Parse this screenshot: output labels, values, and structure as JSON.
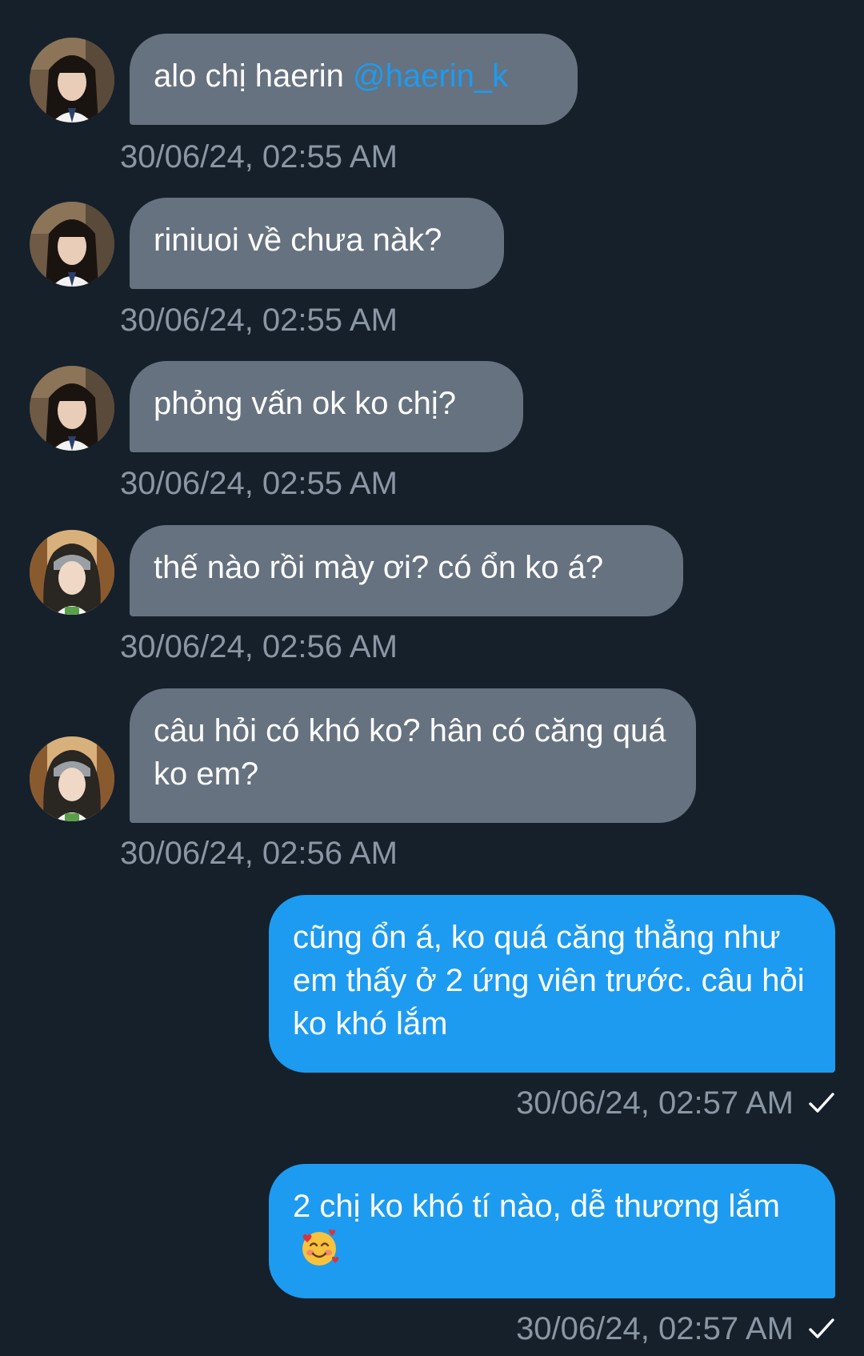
{
  "messages": [
    {
      "id": 1,
      "direction": "in",
      "avatar": "avatar-haerin-icon",
      "text": "alo chị haerin ",
      "mention": "@haerin_k",
      "timestamp": "30/06/24, 02:55 AM"
    },
    {
      "id": 2,
      "direction": "in",
      "avatar": "avatar-haerin-icon",
      "text": "riniuoi về chưa nàk?",
      "timestamp": "30/06/24, 02:55 AM"
    },
    {
      "id": 3,
      "direction": "in",
      "avatar": "avatar-haerin-icon",
      "text": "phỏng vấn ok ko chị?",
      "timestamp": "30/06/24, 02:55 AM"
    },
    {
      "id": 4,
      "direction": "in",
      "avatar": "avatar-second-user-icon",
      "text": "thế nào rồi mày ơi? có ổn ko á?",
      "timestamp": "30/06/24, 02:56 AM"
    },
    {
      "id": 5,
      "direction": "in",
      "avatar": "avatar-second-user-icon",
      "text": "câu hỏi có khó ko? hân có căng quá ko em?",
      "timestamp": "30/06/24, 02:56 AM"
    },
    {
      "id": 6,
      "direction": "out",
      "text": "cũng ổn á, ko quá căng thẳng như em thấy ở 2 ứng viên trước. câu hỏi ko khó lắm",
      "timestamp": "30/06/24, 02:57 AM",
      "status_icon": "checkmark-icon"
    },
    {
      "id": 7,
      "direction": "out",
      "text": "2 chị ko khó tí nào, dễ thương lắm ",
      "emoji": "smiling-face-with-hearts-icon",
      "timestamp": "30/06/24, 02:57 AM",
      "status_icon": "checkmark-icon"
    }
  ],
  "colors": {
    "background": "#15202b",
    "incoming_bubble": "#66727f",
    "outgoing_bubble": "#1d9bf0",
    "mention": "#1d9bf0",
    "timestamp": "#8a96a3"
  }
}
